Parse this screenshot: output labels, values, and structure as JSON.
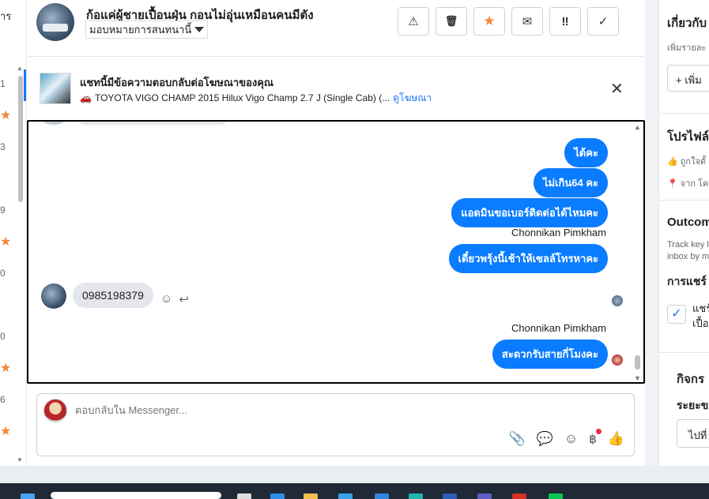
{
  "left_strip": {
    "label_top": "าร",
    "numbers": [
      "1",
      "3",
      "9",
      "0",
      "0",
      "6"
    ]
  },
  "header": {
    "contact_name": "ก้อแค่ผู้ชายเปื้อนฝุ่น กอนไม่อุ่นเหมือนคนมีตัง",
    "assign_label": "มอบหมายการสนทนานี้",
    "action_icons": [
      "warning-icon",
      "trash-icon",
      "star-icon",
      "envelope-icon",
      "double-exclamation-icon",
      "check-icon"
    ],
    "action_glyphs": [
      "⚠",
      "🗑",
      "★",
      "✉",
      "‼",
      "✓"
    ]
  },
  "ad_banner": {
    "title": "แชทนี้มีข้อความตอบกลับต่อโฆษณาของคุณ",
    "subtitle": "TOYOTA VIGO CHAMP 2015 Hilux Vigo Champ 2.7 J (Single Cab) (...",
    "link": "ดูโฆษณา",
    "close_glyph": "✕"
  },
  "messages": {
    "out1": "ได้คะ",
    "out2": "ไม่เกิน64 คะ",
    "out3": "แอดมินขอเบอร์ติดต่อได้ไหมคะ",
    "sender1": "Chonnikan Pimkham",
    "out4": "เดี๋ยวพรุ้งนี้เช้าให้เซลล์โทรหาคะ",
    "in1": "0985198379",
    "sender2": "Chonnikan Pimkham",
    "out5": "สะดวกรับสายกี่โมงคะ"
  },
  "composer": {
    "placeholder": "ตอบกลับใน Messenger...",
    "icons": [
      "paperclip-icon",
      "chat-bubble-icon",
      "emoji-icon",
      "baht-icon",
      "thumbs-up-icon"
    ]
  },
  "right_panel": {
    "section1_title": "เกี่ยวกับ",
    "section1_sub": "เพิ่มรายละ",
    "add_button": "+ เพิ่ม",
    "profile_title": "โปรไฟล์",
    "profile_like": "ถูกใจตั้",
    "profile_from": "จาก โค",
    "outcome_title": "Outcom",
    "outcome_sub1": "Track key l",
    "outcome_sub2": "inbox by m",
    "chat_label": "การแชร์",
    "check_text1": "แชร์",
    "check_text2": "เปื้อ",
    "activity_title": "กิจกร",
    "period_label": "ระยะข",
    "period_value": "ไปที่"
  },
  "colors": {
    "accent": "#0a7cff",
    "star": "#f5873a",
    "link": "#1877f2"
  }
}
